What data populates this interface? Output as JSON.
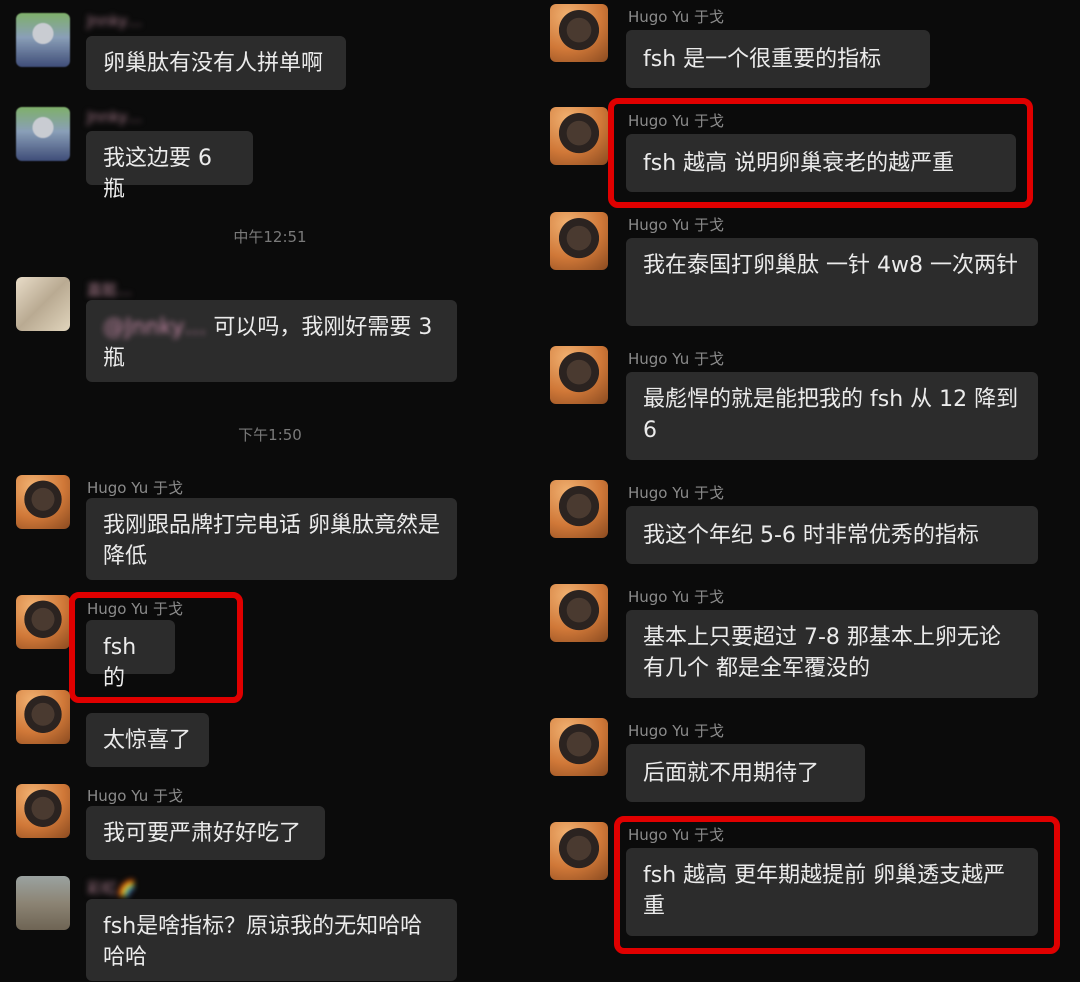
{
  "chat": {
    "left": {
      "m1": {
        "sender": "Jnnky…",
        "text": "卵巢肽有没有人拼单啊"
      },
      "m2": {
        "sender": "Jnnky…",
        "text": "我这边要 6 瓶"
      },
      "time1": "中午12:51",
      "m3": {
        "sender": "嘉懿…",
        "mention": "@Jnnky…",
        "text": " 可以吗，我刚好需要 3 瓶"
      },
      "time2": "下午1:50",
      "m4": {
        "sender": "Hugo Yu 于戈",
        "text": "我刚跟品牌打完电话 卵巢肽竟然是降低"
      },
      "m5": {
        "sender": "Hugo Yu 于戈",
        "text": "fsh 的"
      },
      "m6": {
        "sender": "Hugo Yu 于戈",
        "text": "太惊喜了"
      },
      "m7": {
        "sender": "Hugo Yu 于戈",
        "text": "我可要严肃好好吃了"
      },
      "m8": {
        "sender": "彩虹🌈",
        "text": "fsh是啥指标？原谅我的无知哈哈哈哈"
      }
    },
    "right": {
      "m1": {
        "sender": "Hugo Yu 于戈",
        "text": "fsh 是一个很重要的指标"
      },
      "m2": {
        "sender": "Hugo Yu 于戈",
        "text": "fsh 越高 说明卵巢衰老的越严重"
      },
      "m3": {
        "sender": "Hugo Yu 于戈",
        "text": "我在泰国打卵巢肽 一针 4w8 一次两针"
      },
      "m4": {
        "sender": "Hugo Yu 于戈",
        "text": "最彪悍的就是能把我的 fsh 从 12 降到 6"
      },
      "m5": {
        "sender": "Hugo Yu 于戈",
        "text": "我这个年纪 5-6 时非常优秀的指标"
      },
      "m6": {
        "sender": "Hugo Yu 于戈",
        "text": "基本上只要超过 7-8 那基本上卵无论有几个 都是全军覆没的"
      },
      "m7": {
        "sender": "Hugo Yu 于戈",
        "text": "后面就不用期待了"
      },
      "m8": {
        "sender": "Hugo Yu 于戈",
        "text": "fsh 越高 更年期越提前 卵巢透支越严重"
      }
    }
  },
  "colors": {
    "background": "#0b0b0b",
    "bubble": "#2c2c2c",
    "highlight": "#e00000",
    "sender": "#8b8b8b"
  },
  "icons": {
    "cat_avatar": "cat-avatar-icon",
    "person_avatar": "person-avatar-icon"
  }
}
